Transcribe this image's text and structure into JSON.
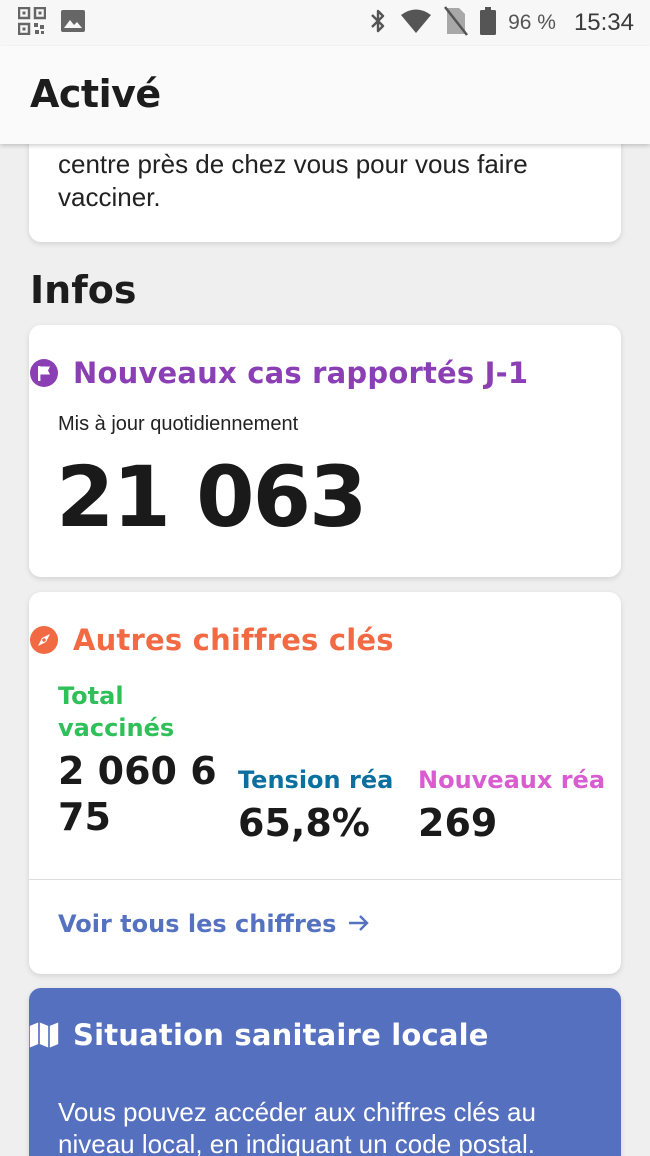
{
  "status_bar": {
    "battery_percent": "96 %",
    "time": "15:34",
    "icons": [
      "qr-code-icon",
      "image-icon",
      "bluetooth-icon",
      "wifi-icon",
      "no-sim-icon",
      "battery-icon"
    ]
  },
  "app_bar": {
    "title": "Activé"
  },
  "top_card": {
    "text": "centre près de chez vous pour vous faire vacciner."
  },
  "infos": {
    "section_title": "Infos",
    "cases": {
      "title": "Nouveaux cas rapportés J-1",
      "subtitle": "Mis à jour quotidiennement",
      "value": "21 063",
      "icon": "flag-icon"
    },
    "key_figures": {
      "title": "Autres chiffres clés",
      "icon": "compass-icon",
      "stats": [
        {
          "label_line1": "Total",
          "label_line2": "vaccinés",
          "value_line1": "2 060 6",
          "value_line2": "75",
          "color": "#2fc05a"
        },
        {
          "label": "Tension réa",
          "value": "65,8%",
          "color": "#0b6fa0"
        },
        {
          "label": "Nouveaux réa",
          "value": "269",
          "color": "#d85dd0"
        }
      ],
      "link_label": "Voir tous les chiffres",
      "link_icon": "arrow-right-icon"
    },
    "local": {
      "title": "Situation sanitaire locale",
      "icon": "map-icon",
      "text": "Vous pouvez accéder aux chiffres clés au niveau local, en indiquant un code postal."
    }
  },
  "colors": {
    "purple": "#8b3fb5",
    "orange": "#f26a44",
    "green": "#2fc05a",
    "teal": "#0b6fa0",
    "pink": "#d85dd0",
    "link_blue": "#5472c0",
    "local_blue": "#5670c0"
  }
}
